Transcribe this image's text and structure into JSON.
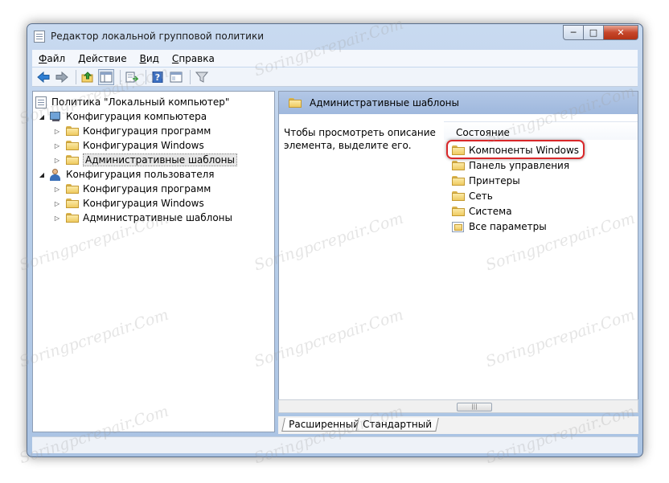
{
  "window": {
    "title": "Редактор локальной групповой политики"
  },
  "menubar": {
    "items": [
      {
        "label": "Файл",
        "accel": "Ф"
      },
      {
        "label": "Действие",
        "accel": "Д"
      },
      {
        "label": "Вид",
        "accel": "В"
      },
      {
        "label": "Справка",
        "accel": "С"
      }
    ]
  },
  "tree": {
    "root": "Политика \"Локальный компьютер\"",
    "computer": {
      "label": "Конфигурация компьютера",
      "children": [
        "Конфигурация программ",
        "Конфигурация Windows",
        "Административные шаблоны"
      ]
    },
    "user": {
      "label": "Конфигурация пользователя",
      "children": [
        "Конфигурация программ",
        "Конфигурация Windows",
        "Административные шаблоны"
      ]
    }
  },
  "content": {
    "header_title": "Административные шаблоны",
    "description": "Чтобы просмотреть описание элемента, выделите его.",
    "column_header": "Состояние",
    "items": [
      "Компоненты Windows",
      "Панель управления",
      "Принтеры",
      "Сеть",
      "Система",
      "Все параметры"
    ]
  },
  "tabs": {
    "extended": "Расширенный",
    "standard": "Стандартный"
  },
  "watermark": "Soringpcrepair.Com",
  "colors": {
    "highlight": "#d9282a",
    "header": "#a9c0e2"
  }
}
